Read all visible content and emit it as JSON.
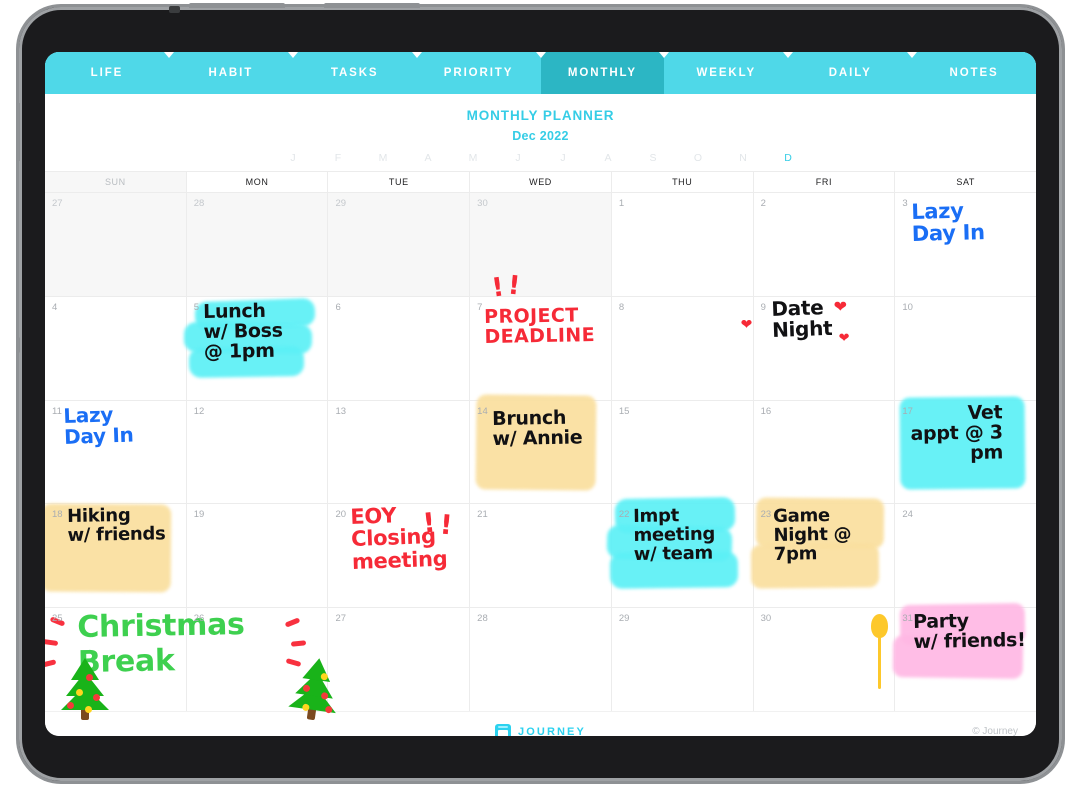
{
  "tabs": [
    {
      "label": "LIFE",
      "active": false
    },
    {
      "label": "HABIT",
      "active": false
    },
    {
      "label": "TASKS",
      "active": false
    },
    {
      "label": "PRIORITY",
      "active": false
    },
    {
      "label": "MONTHLY",
      "active": true
    },
    {
      "label": "WEEKLY",
      "active": false
    },
    {
      "label": "DAILY",
      "active": false
    },
    {
      "label": "NOTES",
      "active": false
    }
  ],
  "header": {
    "title": "MONTHLY PLANNER",
    "month_year": "Dec 2022",
    "accent_color": "#35cde6",
    "month_letters": [
      "J",
      "F",
      "M",
      "A",
      "M",
      "J",
      "J",
      "A",
      "S",
      "O",
      "N",
      "D"
    ],
    "current_month_index": 11
  },
  "weekdays": [
    {
      "label": "SUN",
      "muted": true
    },
    {
      "label": "MON",
      "muted": false
    },
    {
      "label": "TUE",
      "muted": false
    },
    {
      "label": "WED",
      "muted": false
    },
    {
      "label": "THU",
      "muted": false
    },
    {
      "label": "FRI",
      "muted": false
    },
    {
      "label": "SAT",
      "muted": false
    }
  ],
  "weeks": [
    [
      {
        "day": "27",
        "outside": true
      },
      {
        "day": "28",
        "outside": true
      },
      {
        "day": "29",
        "outside": true
      },
      {
        "day": "30",
        "outside": true
      },
      {
        "day": "1",
        "outside": false
      },
      {
        "day": "2",
        "outside": false
      },
      {
        "day": "3",
        "outside": false,
        "note": "Lazy\nDay In",
        "ink": "blue"
      }
    ],
    [
      {
        "day": "4",
        "outside": false
      },
      {
        "day": "5",
        "outside": false,
        "note": "Lunch\nw/ Boss\n@ 1pm",
        "ink": "black",
        "highlight": "cyan"
      },
      {
        "day": "6",
        "outside": false
      },
      {
        "day": "7",
        "outside": false,
        "note": "PROJECT\nDEADLINE",
        "ink": "red",
        "marks": "exclamations"
      },
      {
        "day": "8",
        "outside": false
      },
      {
        "day": "9",
        "outside": false,
        "note": "Date\nNight",
        "ink": "black",
        "marks": "hearts"
      },
      {
        "day": "10",
        "outside": false
      }
    ],
    [
      {
        "day": "11",
        "outside": false,
        "note": "Lazy\nDay In",
        "ink": "blue"
      },
      {
        "day": "12",
        "outside": false
      },
      {
        "day": "13",
        "outside": false
      },
      {
        "day": "14",
        "outside": false,
        "note": "Brunch\nw/ Annie",
        "ink": "black",
        "highlight": "yellow"
      },
      {
        "day": "15",
        "outside": false
      },
      {
        "day": "16",
        "outside": false
      },
      {
        "day": "17",
        "outside": false,
        "note": "Vet\nappt @ 3\npm",
        "ink": "black",
        "highlight": "cyan"
      }
    ],
    [
      {
        "day": "18",
        "outside": false,
        "note": "Hiking\nw/ friends",
        "ink": "black",
        "highlight": "yellow"
      },
      {
        "day": "19",
        "outside": false
      },
      {
        "day": "20",
        "outside": false,
        "note": "EOY\nClosing\nmeeting",
        "ink": "red",
        "marks": "exclamations"
      },
      {
        "day": "21",
        "outside": false
      },
      {
        "day": "22",
        "outside": false,
        "note": "Impt\nmeeting\nw/ team",
        "ink": "black",
        "highlight": "cyan"
      },
      {
        "day": "23",
        "outside": false,
        "note": "Game\nNight @\n7pm",
        "ink": "black",
        "highlight": "yellow"
      },
      {
        "day": "24",
        "outside": false
      }
    ],
    [
      {
        "day": "25",
        "outside": false,
        "note": "Christmas\nBreak",
        "ink": "green",
        "marks": "christmas"
      },
      {
        "day": "26",
        "outside": false
      },
      {
        "day": "27",
        "outside": false
      },
      {
        "day": "28",
        "outside": false
      },
      {
        "day": "29",
        "outside": false
      },
      {
        "day": "30",
        "outside": false
      },
      {
        "day": "31",
        "outside": false,
        "note": "Party\nw/ friends!",
        "ink": "black",
        "highlight": "pink",
        "marks": "balloon"
      }
    ]
  ],
  "footer": {
    "brand": "JOURNEY",
    "copyright": "© Journey"
  }
}
